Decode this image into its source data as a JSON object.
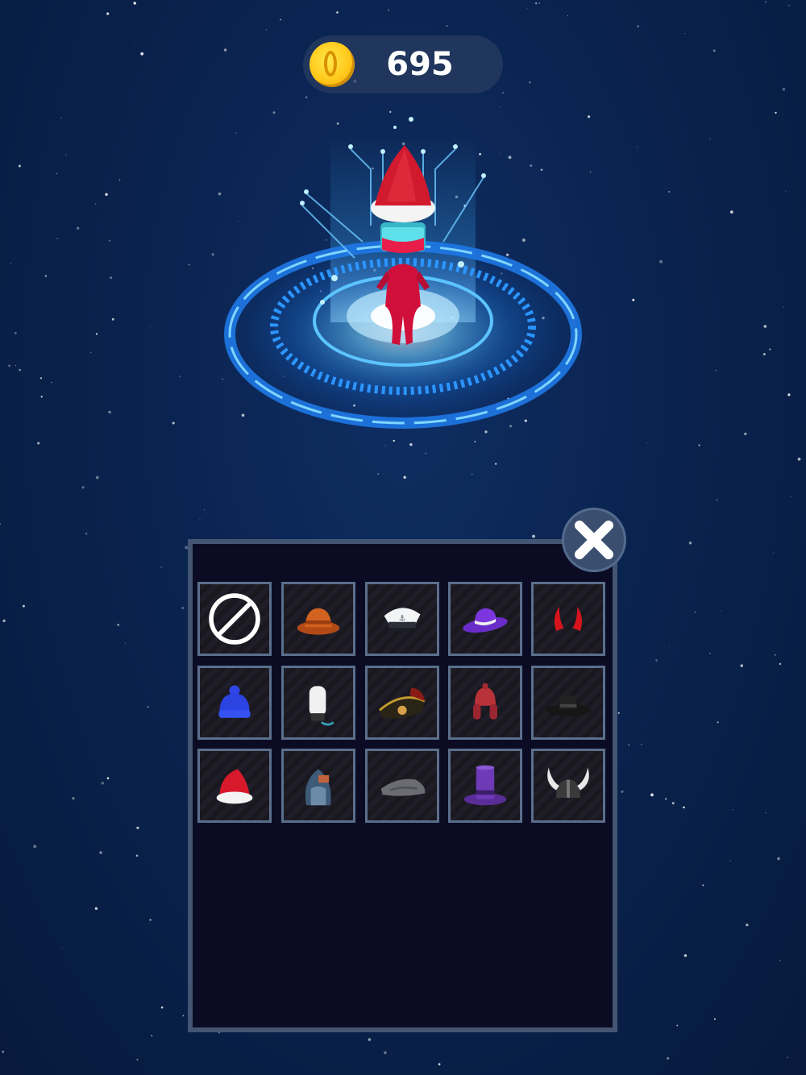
{
  "coins": {
    "value": "695",
    "icon": "gold-coin-icon"
  },
  "character": {
    "equipped_hat": "santa-hat"
  },
  "inventory": {
    "slots": [
      {
        "name": "none-slot",
        "icon": "no-hat-icon"
      },
      {
        "name": "bucket-hat-slot",
        "icon": "bucket-hat-icon"
      },
      {
        "name": "captain-hat-slot",
        "icon": "captain-hat-icon"
      },
      {
        "name": "purple-fedora-slot",
        "icon": "fedora-hat-icon"
      },
      {
        "name": "devil-horns-slot",
        "icon": "devil-horns-icon"
      },
      {
        "name": "blue-beanie-slot",
        "icon": "beanie-icon"
      },
      {
        "name": "chef-hat-slot",
        "icon": "chef-hat-icon"
      },
      {
        "name": "pirate-hat-slot",
        "icon": "pirate-hat-icon"
      },
      {
        "name": "trapper-hat-slot",
        "icon": "trapper-hat-icon"
      },
      {
        "name": "black-hat-slot",
        "icon": "black-hat-icon"
      },
      {
        "name": "santa-hat-slot",
        "icon": "santa-hat-icon"
      },
      {
        "name": "hood-slot",
        "icon": "hood-icon"
      },
      {
        "name": "tricorn-slot",
        "icon": "tricorn-icon"
      },
      {
        "name": "purple-top-hat-slot",
        "icon": "top-hat-icon"
      },
      {
        "name": "viking-helmet-slot",
        "icon": "viking-helmet-icon"
      }
    ]
  },
  "colors": {
    "panel_bg": "#0b0c24",
    "panel_border": "#435572",
    "slot_border": "#5b6f8c",
    "accent_glow": "#2f9bff"
  }
}
